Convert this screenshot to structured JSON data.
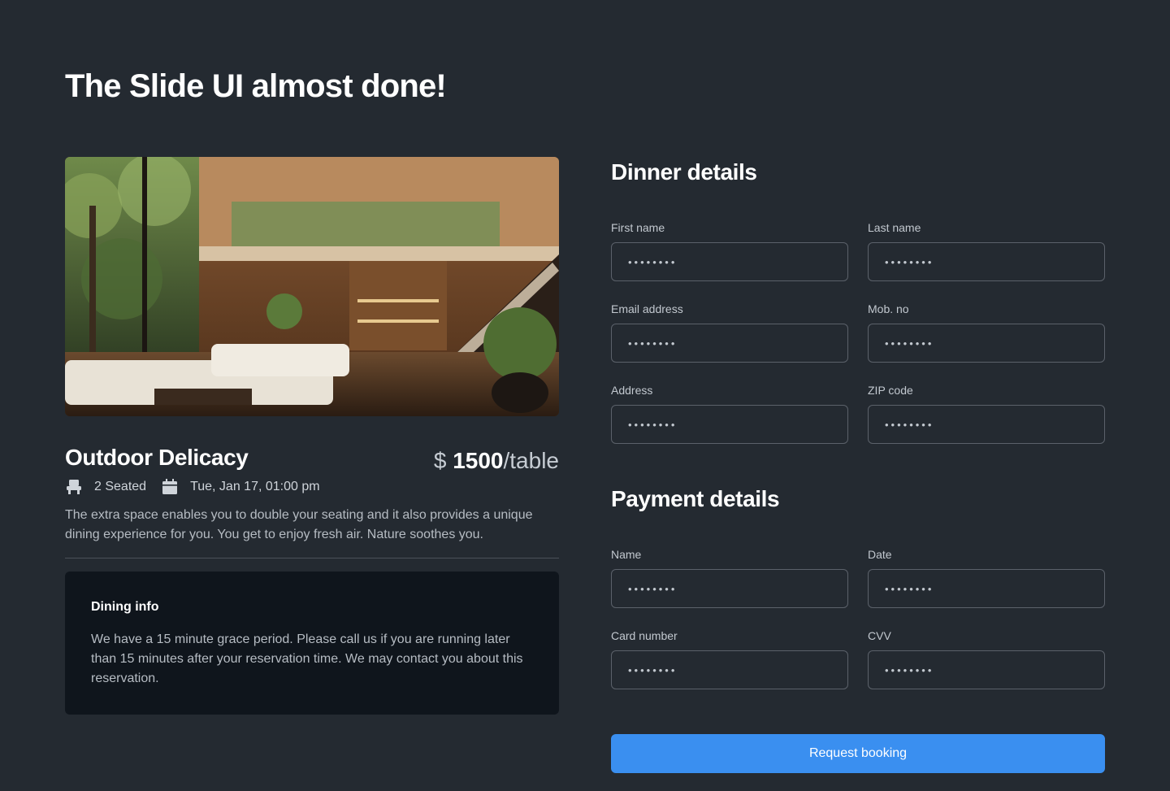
{
  "page": {
    "title": "The Slide UI almost done!"
  },
  "listing": {
    "title": "Outdoor Delicacy",
    "price_currency": "$",
    "price_amount": "1500",
    "price_unit": "/table",
    "seating": "2 Seated",
    "datetime": "Tue, Jan 17, 01:00 pm",
    "description": "The extra space enables you to double your seating and it also provides a unique dining experience for you. You get to enjoy fresh air. Nature soothes you.",
    "icons": {
      "seat": "chair-icon",
      "date": "calendar-icon"
    }
  },
  "dining_info": {
    "title": "Dining info",
    "text": "We have a 15 minute grace period. Please call us if you are running later than 15 minutes after your reservation time. We may contact you about this reservation."
  },
  "dinner": {
    "title": "Dinner details",
    "fields": [
      {
        "label": "First name",
        "value": "••••••••"
      },
      {
        "label": "Last name",
        "value": "••••••••"
      },
      {
        "label": "Email address",
        "value": "••••••••"
      },
      {
        "label": "Mob. no",
        "value": "••••••••"
      },
      {
        "label": "Address",
        "value": "••••••••"
      },
      {
        "label": "ZIP code",
        "value": "••••••••"
      }
    ]
  },
  "payment": {
    "title": "Payment details",
    "fields": [
      {
        "label": "Name",
        "value": "••••••••"
      },
      {
        "label": "Date",
        "value": "••••••••"
      },
      {
        "label": "Card number",
        "value": "••••••••"
      },
      {
        "label": "CVV",
        "value": "••••••••"
      }
    ]
  },
  "actions": {
    "submit_label": "Request booking"
  },
  "colors": {
    "background": "#242a31",
    "panel": "#0f151c",
    "accent": "#3a8ff0"
  }
}
